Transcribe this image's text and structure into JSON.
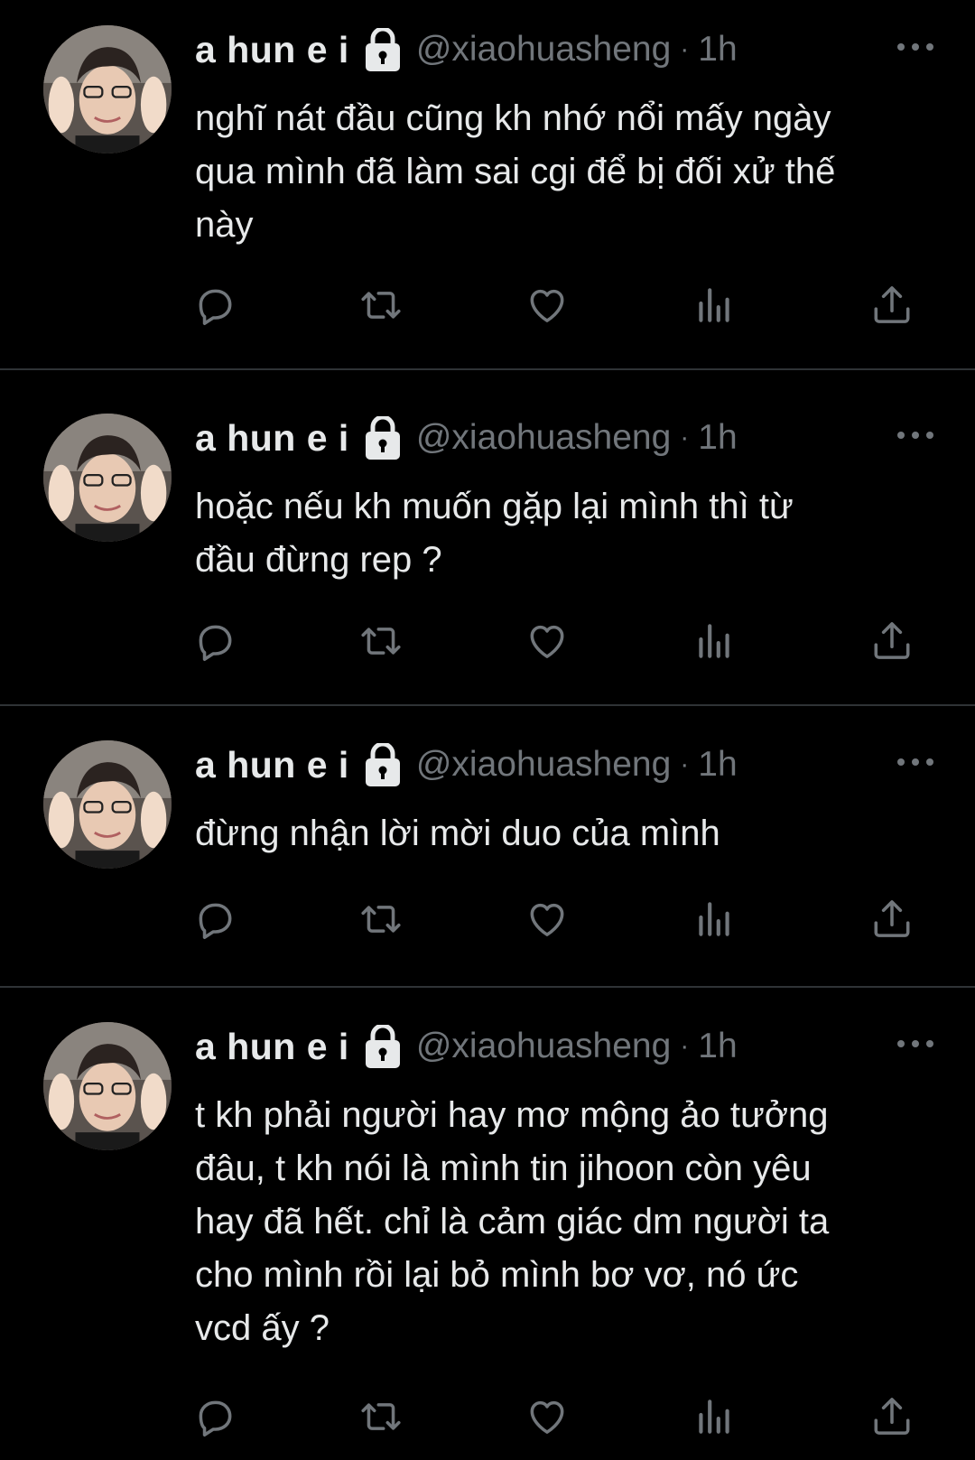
{
  "tweets": [
    {
      "display_name": "a hun e i",
      "handle": "@xiaohuasheng",
      "separator": "·",
      "time": "1h",
      "text": "nghĩ nát đầu cũng kh nhớ nổi mấy ngày\nqua mình đã làm sai cgi để bị đối xử thế\nnày"
    },
    {
      "display_name": "a hun e i",
      "handle": "@xiaohuasheng",
      "separator": "·",
      "time": "1h",
      "text": "hoặc nếu kh muốn gặp lại mình thì từ\nđầu đừng rep ?"
    },
    {
      "display_name": "a hun e i",
      "handle": "@xiaohuasheng",
      "separator": "·",
      "time": "1h",
      "text": "đừng nhận lời mời duo của mình"
    },
    {
      "display_name": "a hun e i",
      "handle": "@xiaohuasheng",
      "separator": "·",
      "time": "1h",
      "text": "t kh phải người hay mơ mộng ảo tưởng\nđâu, t kh nói là mình tin jihoon còn yêu\nhay đã hết. chỉ là cảm giác dm người ta\ncho mình rồi lại bỏ mình bơ vơ, nó ức\nvcd ấy ?"
    }
  ],
  "icons": {
    "reply": "reply-icon",
    "retweet": "retweet-icon",
    "like": "heart-icon",
    "views": "analytics-icon",
    "share": "share-icon",
    "protected": "lock-icon",
    "more": "more-icon"
  },
  "colors": {
    "background": "#000000",
    "primary_text": "#e7e9ea",
    "secondary_text": "#71767b",
    "divider": "#2f3336"
  }
}
